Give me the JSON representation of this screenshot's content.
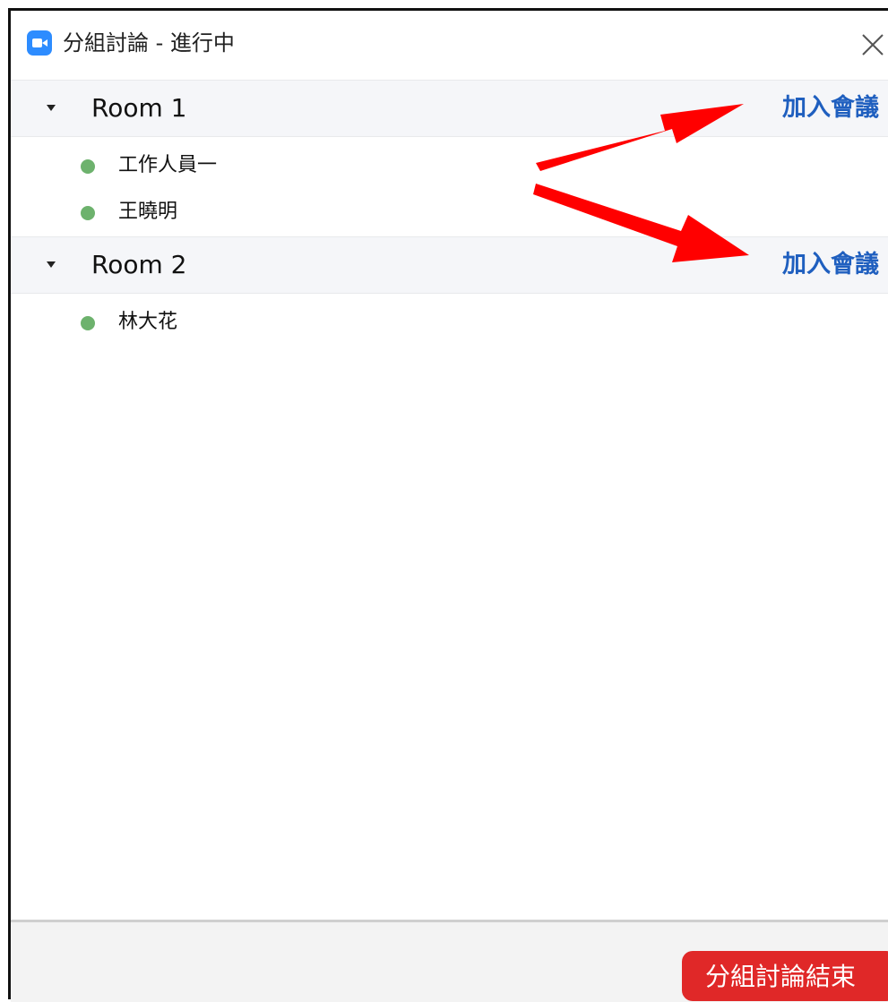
{
  "window": {
    "title": "分組討論 - 進行中",
    "app_icon": "zoom-camera-icon",
    "close_icon": "close-icon"
  },
  "rooms": [
    {
      "name": "Room 1",
      "join_label": "加入會議",
      "participants": [
        {
          "name": "工作人員一",
          "status_color": "#6db26d"
        },
        {
          "name": "王曉明",
          "status_color": "#6db26d"
        }
      ]
    },
    {
      "name": "Room 2",
      "join_label": "加入會議",
      "participants": [
        {
          "name": "林大花",
          "status_color": "#6db26d"
        }
      ]
    }
  ],
  "footer": {
    "end_button_label": "分組討論結束"
  },
  "colors": {
    "accent_link": "#1f5fbf",
    "end_button": "#e02828",
    "annotation_arrow": "#ff0000"
  }
}
